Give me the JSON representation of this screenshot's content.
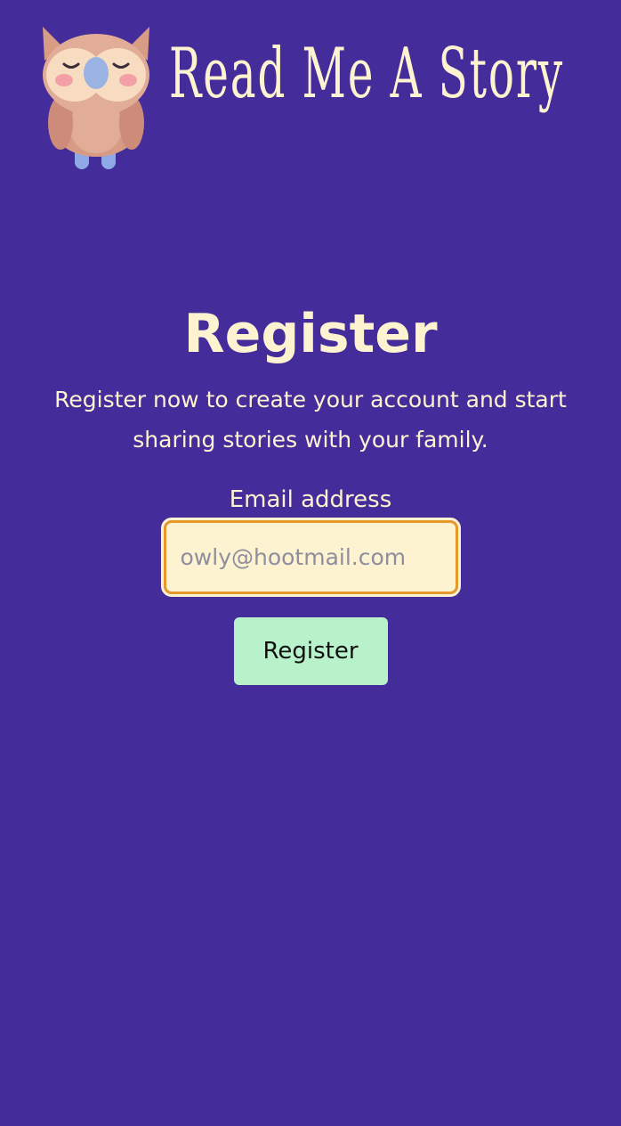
{
  "header": {
    "logo_icon": "owl-icon",
    "site_title": "Read Me A Story"
  },
  "main": {
    "title": "Register",
    "intro": "Register now to create your account and start sharing stories with your family.",
    "form": {
      "email_label": "Email address",
      "email_value": "",
      "email_placeholder": "owly@hootmail.com",
      "submit_label": "Register"
    }
  },
  "colors": {
    "background": "#442c9b",
    "text": "#fef3d0",
    "input_background": "#fef3d0",
    "input_border": "#e7982a",
    "button_background": "#b8f2cb"
  }
}
